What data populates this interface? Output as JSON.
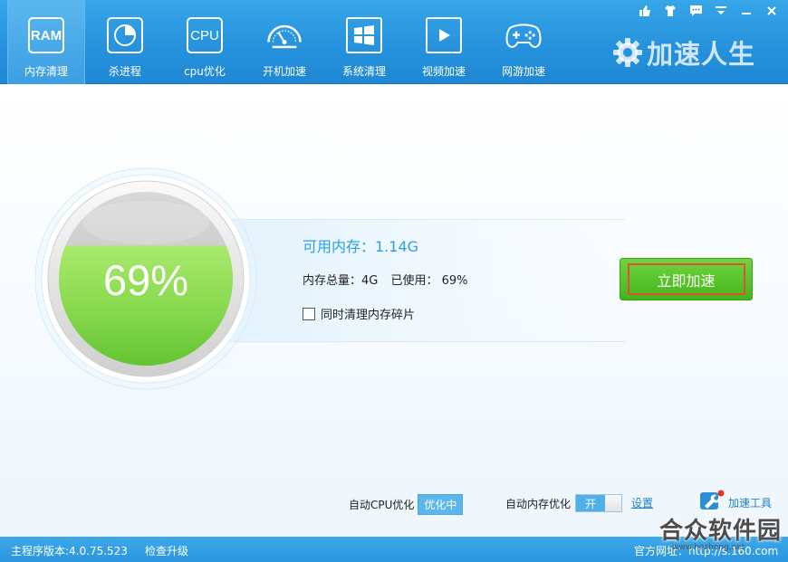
{
  "nav": [
    {
      "label": "内存清理",
      "icon": "RAM",
      "active": true
    },
    {
      "label": "杀进程",
      "icon": "pie-chart"
    },
    {
      "label": "cpu优化",
      "icon": "CPU"
    },
    {
      "label": "开机加速",
      "icon": "speedometer"
    },
    {
      "label": "系统清理",
      "icon": "windows-logo"
    },
    {
      "label": "视频加速",
      "icon": "play"
    },
    {
      "label": "网游加速",
      "icon": "gamepad"
    }
  ],
  "window_controls": [
    "thumbs-up-icon",
    "tshirt-icon",
    "chat-icon",
    "dropdown-icon",
    "minimize-icon",
    "close-icon"
  ],
  "brand": {
    "text": "加速人生"
  },
  "memory": {
    "percent_text": "69%",
    "used_fraction": 0.69,
    "available": "可用内存：1.14G",
    "total": "内存总量：4G",
    "used": "已使用： 69%",
    "defrag_label": "同时清理内存碎片",
    "defrag_checked": false
  },
  "boost_button": "立即加速",
  "auto_cpu": {
    "label": "自动CPU优化",
    "state": "优化中"
  },
  "auto_mem": {
    "label": "自动内存优化",
    "state": "开"
  },
  "settings_link": "设置",
  "tools_label": "加速工具",
  "status": {
    "version": "主程序版本:4.0.75.523",
    "check_update": "检查升级",
    "official_site": "官方网址：http://s.160.com"
  },
  "watermark": {
    "text": "合众软件园",
    "sub": "www.hezhong.net"
  },
  "colors": {
    "header_blue": "#2591dc",
    "accent_blue": "#2ca0de",
    "gauge_green": "#8fe050",
    "button_green": "#44b51c",
    "button_border_red": "#e24f37"
  }
}
